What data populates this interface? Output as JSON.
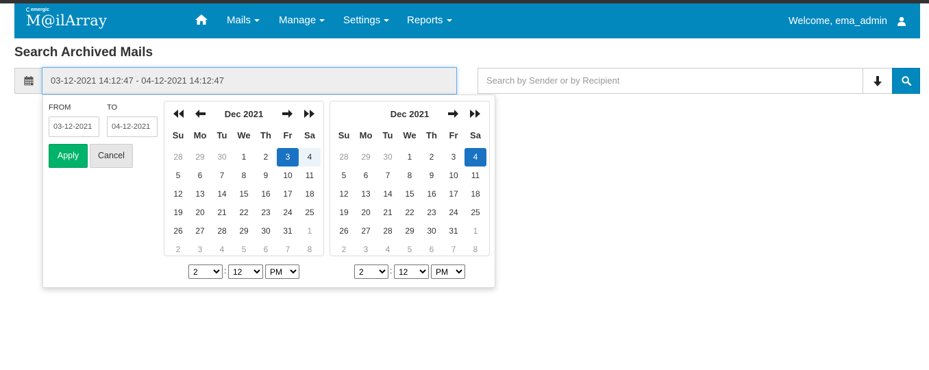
{
  "brand": {
    "small": "emergic",
    "name": "M@ilArray"
  },
  "nav": {
    "items": [
      "Mails",
      "Manage",
      "Settings",
      "Reports"
    ],
    "welcome": "Welcome, ema_admin"
  },
  "page": {
    "title": "Search Archived Mails"
  },
  "search": {
    "date_range": "03-12-2021 14:12:47 - 04-12-2021 14:12:47",
    "placeholder": "Search by Sender or by Recipient"
  },
  "picker": {
    "from_label": "FROM",
    "to_label": "TO",
    "from_value": "03-12-2021",
    "to_value": "04-12-2021",
    "apply_label": "Apply",
    "cancel_label": "Cancel",
    "weekdays": [
      "Su",
      "Mo",
      "Tu",
      "We",
      "Th",
      "Fr",
      "Sa"
    ],
    "calendars": [
      {
        "month": "Dec 2021",
        "weeks": [
          [
            "28",
            "29",
            "30",
            "1",
            "2",
            "3",
            "4"
          ],
          [
            "5",
            "6",
            "7",
            "8",
            "9",
            "10",
            "11"
          ],
          [
            "12",
            "13",
            "14",
            "15",
            "16",
            "17",
            "18"
          ],
          [
            "19",
            "20",
            "21",
            "22",
            "23",
            "24",
            "25"
          ],
          [
            "26",
            "27",
            "28",
            "29",
            "30",
            "31",
            "1"
          ],
          [
            "2",
            "3",
            "4",
            "5",
            "6",
            "7",
            "8"
          ]
        ],
        "selected_start": "3",
        "in_range": [
          "4"
        ],
        "time": {
          "hour": "2",
          "minute": "12",
          "ampm": "PM"
        }
      },
      {
        "month": "Dec 2021",
        "weeks": [
          [
            "28",
            "29",
            "30",
            "1",
            "2",
            "3",
            "4"
          ],
          [
            "5",
            "6",
            "7",
            "8",
            "9",
            "10",
            "11"
          ],
          [
            "12",
            "13",
            "14",
            "15",
            "16",
            "17",
            "18"
          ],
          [
            "19",
            "20",
            "21",
            "22",
            "23",
            "24",
            "25"
          ],
          [
            "26",
            "27",
            "28",
            "29",
            "30",
            "31",
            "1"
          ],
          [
            "2",
            "3",
            "4",
            "5",
            "6",
            "7",
            "8"
          ]
        ],
        "selected_end": "4",
        "time": {
          "hour": "2",
          "minute": "12",
          "ampm": "PM"
        }
      }
    ]
  },
  "colors": {
    "navbar": "#0288bd",
    "apply": "#00b36b",
    "selected": "#1a73c2"
  }
}
